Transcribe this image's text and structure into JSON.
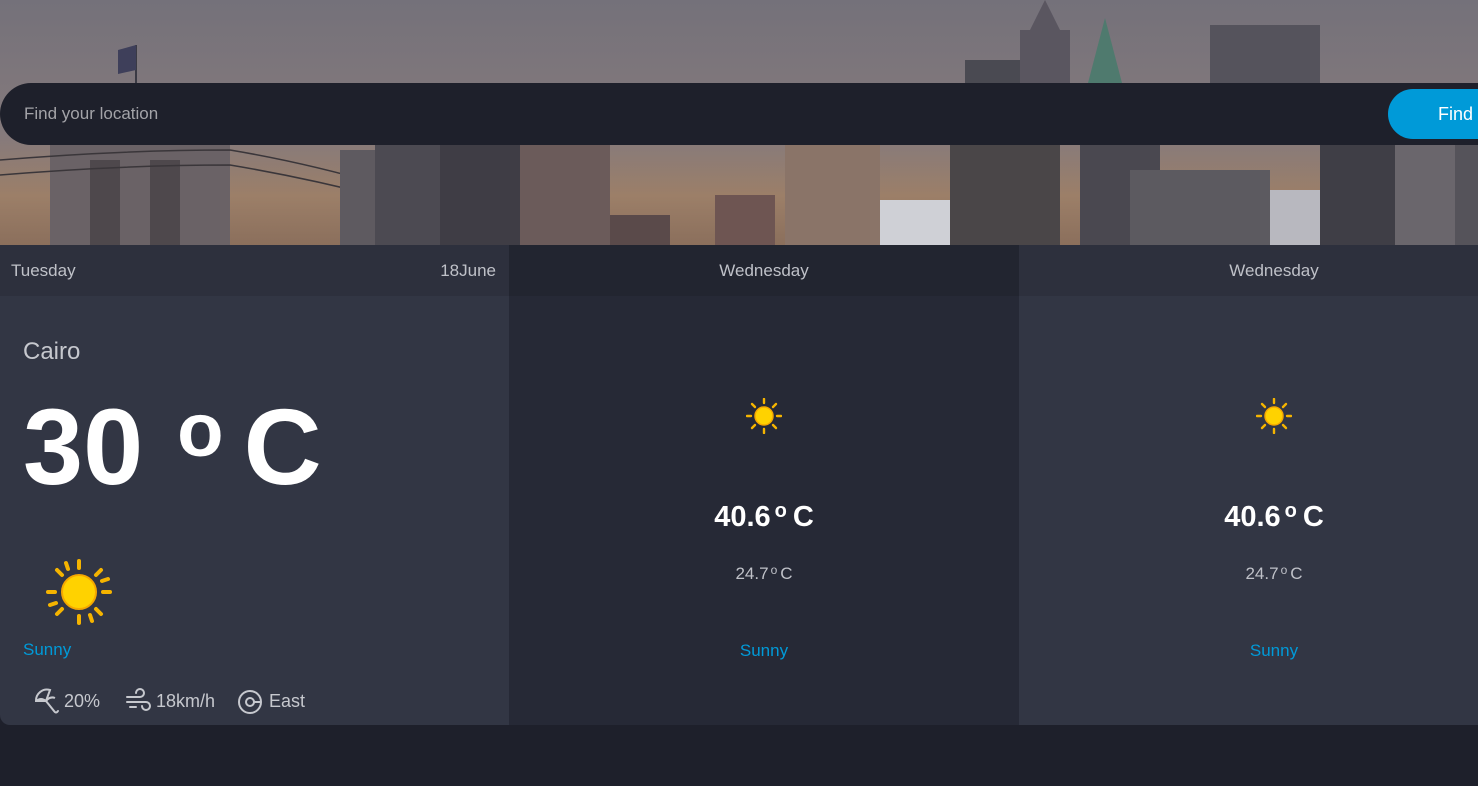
{
  "search": {
    "placeholder": "Find your location",
    "button_label": "Find"
  },
  "today": {
    "day": "Tuesday",
    "date": "18June",
    "city": "Cairo",
    "temp_value": "30",
    "temp_degree": "o",
    "temp_unit": "C",
    "condition": "Sunny",
    "condition_icon": "sun-icon",
    "rain": "20%",
    "wind_speed": "18km/h",
    "wind_direction": "East"
  },
  "forecast": [
    {
      "day": "Wednesday",
      "max_value": "40.6",
      "max_degree": "o",
      "max_unit": "C",
      "min_value": "24.7",
      "min_degree": "o",
      "min_unit": "C",
      "condition": "Sunny",
      "condition_icon": "sun-icon"
    },
    {
      "day": "Wednesday",
      "max_value": "40.6",
      "max_degree": "o",
      "max_unit": "C",
      "min_value": "24.7",
      "min_degree": "o",
      "min_unit": "C",
      "condition": "Sunny",
      "condition_icon": "sun-icon"
    }
  ],
  "colors": {
    "accent": "#009ad8",
    "background": "#1e202b",
    "card_light": "#323644",
    "card_dark": "#262936"
  }
}
